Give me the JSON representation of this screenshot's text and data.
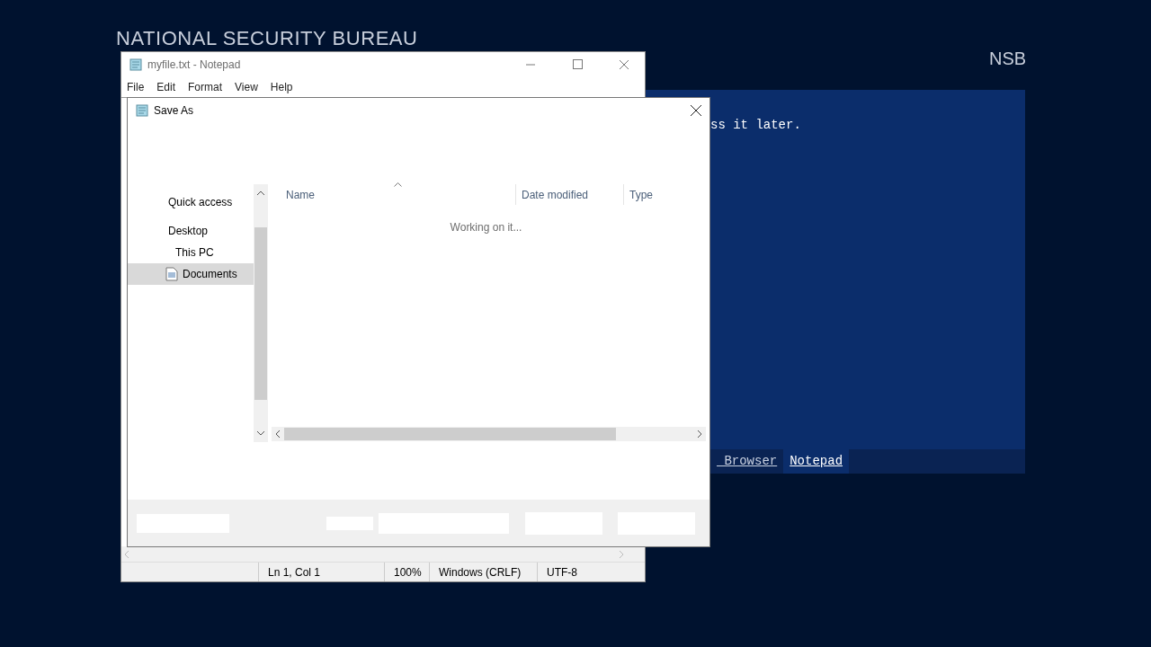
{
  "desktop": {
    "heading": "NATIONAL SECURITY BUREAU",
    "logo": "NSB"
  },
  "panel": {
    "text": "ss it later.",
    "tabs": [
      {
        "label": " Browser",
        "selected": false
      },
      {
        "label": "Notepad",
        "selected": true
      }
    ]
  },
  "notepad": {
    "title": "myfile.txt - Notepad",
    "menu": [
      "File",
      "Edit",
      "Format",
      "View",
      "Help"
    ],
    "status_bar": [
      "Ln 1, Col 1",
      "100%",
      "Windows (CRLF)",
      "UTF-8"
    ]
  },
  "save_dialog": {
    "title": "Save As",
    "nav_items": [
      {
        "label": "Quick access",
        "selected": false,
        "kind": "plain"
      },
      {
        "label": "Desktop",
        "selected": false,
        "kind": "plain"
      },
      {
        "label": "This PC",
        "selected": false,
        "kind": "plain"
      },
      {
        "label": "Documents",
        "selected": true,
        "kind": "document"
      }
    ],
    "columns": [
      "Name",
      "Date modified",
      "Type"
    ],
    "message": "Working on it..."
  }
}
